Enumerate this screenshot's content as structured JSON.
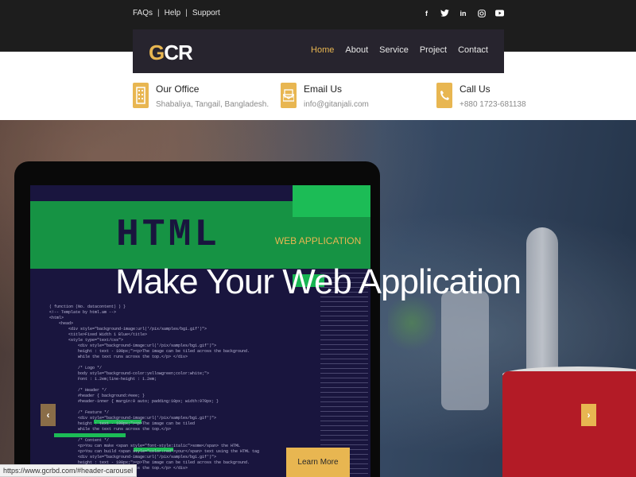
{
  "topbar": {
    "links": [
      "FAQs",
      "Help",
      "Support"
    ],
    "social": [
      {
        "icon": "facebook-icon",
        "glyph": "f"
      },
      {
        "icon": "twitter-icon",
        "glyph": "t"
      },
      {
        "icon": "linkedin-icon",
        "glyph": "in"
      },
      {
        "icon": "instagram-icon",
        "glyph": "◎"
      },
      {
        "icon": "youtube-icon",
        "glyph": "▶"
      }
    ]
  },
  "nav": {
    "logo_first": "G",
    "logo_rest": "CR",
    "items": [
      "Home",
      "About",
      "Service",
      "Project",
      "Contact"
    ],
    "active": "Home"
  },
  "contact": {
    "office": {
      "title": "Our Office",
      "value": "Shabaliya, Tangail, Bangladesh."
    },
    "email": {
      "title": "Email Us",
      "value": "info@gitanjali.com"
    },
    "call": {
      "title": "Call Us",
      "value": "+880 1723-681138"
    }
  },
  "hero": {
    "screen_text": "HTML",
    "kicker": "WEB APPLICATION",
    "headline": "Make Your Web Application",
    "button": "Learn More",
    "prev": "‹",
    "next": "›"
  },
  "status": {
    "url": "https://www.gcrbd.com/#header-carousel"
  },
  "colors": {
    "accent": "#e8b651",
    "dark": "#1d1d1d",
    "navbox": "#27242e"
  }
}
